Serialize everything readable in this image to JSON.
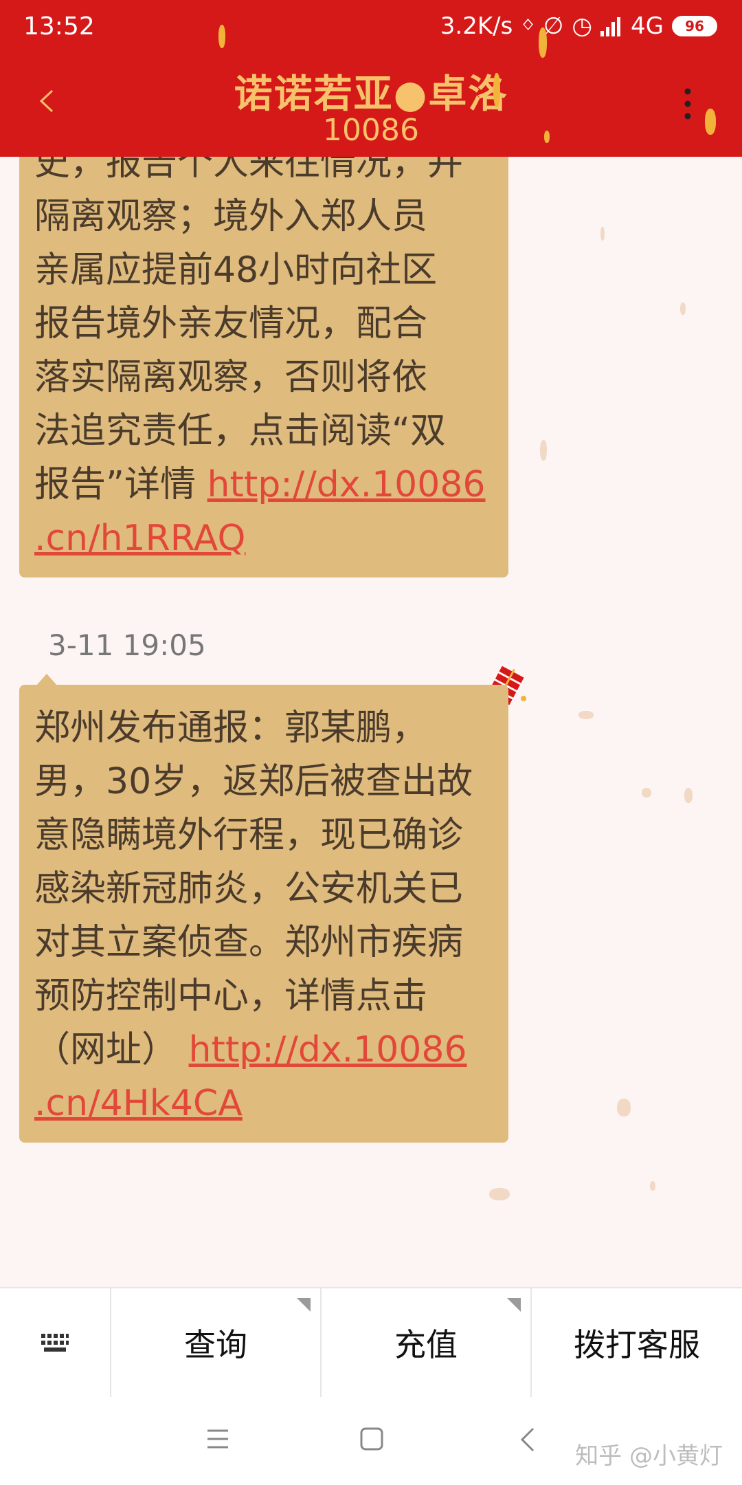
{
  "status_bar": {
    "time": "13:52",
    "network_speed": "3.2K/s",
    "network_type": "4G",
    "battery": "96"
  },
  "header": {
    "title": "诺诺若亚●卓洛",
    "number": "10086"
  },
  "messages": [
    {
      "lines": [
        "史，报告个人来往情况，并",
        "隔离观察；境外入郑人员",
        "亲属应提前48小时向社区",
        "报告境外亲友情况，配合",
        "落实隔离观察，否则将依",
        "法追究责任，点击阅读“双",
        "报告”详情 "
      ],
      "link_line1": "http://dx.10086",
      "link_line2": ".cn/h1RRAQ"
    },
    {
      "timestamp": "3-11 19:05",
      "lines": [
        "郑州发布通报：郭某鹏，",
        "男，30岁，返郑后被查出故",
        "意隐瞒境外行程，现已确诊",
        "感染新冠肺炎，公安机关已",
        "对其立案侦查。郑州市疾病",
        "预防控制中心，详情点击",
        "（网址） "
      ],
      "link_line1": "http://dx.10086",
      "link_line2": ".cn/4Hk4CA"
    }
  ],
  "menu": {
    "keyboard_icon": "keyboard-icon",
    "query": "查询",
    "recharge": "充值",
    "call_service": "拨打客服"
  },
  "watermark": "知乎 @小黄灯",
  "colors": {
    "header_bg": "#d51818",
    "title": "#f6c36c",
    "bubble": "#e0bb7e",
    "link": "#e2483a"
  }
}
